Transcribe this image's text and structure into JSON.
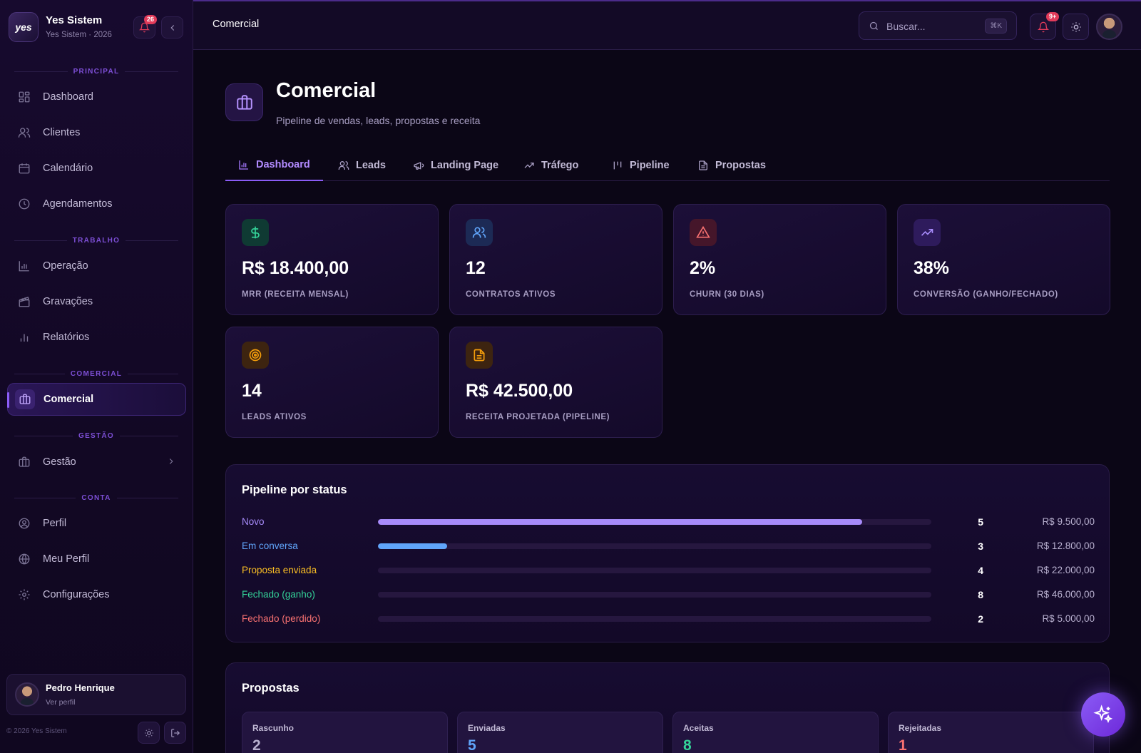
{
  "app": {
    "name": "Yes Sistem",
    "subtitle": "Yes Sistem · 2026",
    "logo_text": "yes",
    "notifications_badge": "26",
    "copyright": "© 2026 Yes Sistem"
  },
  "sidebar": {
    "sections": {
      "principal": "PRINCIPAL",
      "trabalho": "TRABALHO",
      "comercial": "COMERCIAL",
      "gestao": "GESTÃO",
      "conta": "CONTA"
    },
    "items": {
      "dashboard": "Dashboard",
      "clientes": "Clientes",
      "calendario": "Calendário",
      "agendamentos": "Agendamentos",
      "operacao": "Operação",
      "gravacoes": "Gravações",
      "relatorios": "Relatórios",
      "comercial": "Comercial",
      "gestao": "Gestão",
      "perfil": "Perfil",
      "meu_perfil": "Meu Perfil",
      "configuracoes": "Configurações"
    },
    "active": "comercial",
    "user": {
      "name": "Pedro Henrique",
      "link": "Ver perfil"
    }
  },
  "topbar": {
    "title": "Comercial",
    "search_placeholder": "Buscar...",
    "search_shortcut": "⌘K",
    "notifications_badge": "9+"
  },
  "page": {
    "title": "Comercial",
    "subtitle": "Pipeline de vendas, leads, propostas e receita"
  },
  "tabs": {
    "dashboard": "Dashboard",
    "leads": "Leads",
    "landing": "Landing Page",
    "trafego": "Tráfego",
    "pipeline": "Pipeline",
    "propostas": "Propostas"
  },
  "kpis": [
    {
      "value": "R$ 18.400,00",
      "label": "MRR (RECEITA MENSAL)",
      "icon": "dollar-icon",
      "color": "#34d399"
    },
    {
      "value": "12",
      "label": "CONTRATOS ATIVOS",
      "icon": "users-icon",
      "color": "#60a5fa"
    },
    {
      "value": "2%",
      "label": "CHURN (30 DIAS)",
      "icon": "alert-triangle-icon",
      "color": "#f87171"
    },
    {
      "value": "38%",
      "label": "CONVERSÃO (GANHO/FECHADO)",
      "icon": "trending-up-icon",
      "color": "#a78bfa"
    },
    {
      "value": "14",
      "label": "LEADS ATIVOS",
      "icon": "target-icon",
      "color": "#f59e0b"
    },
    {
      "value": "R$ 42.500,00",
      "label": "RECEITA PROJETADA (PIPELINE)",
      "icon": "document-icon",
      "color": "#f59e0b"
    }
  ],
  "pipeline": {
    "title": "Pipeline por status",
    "rows": [
      {
        "label": "Novo",
        "count": "5",
        "amount": "R$ 9.500,00",
        "fill": 0.875,
        "color": "#a78bfa"
      },
      {
        "label": "Em conversa",
        "count": "3",
        "amount": "R$ 12.800,00",
        "fill": 0.125,
        "color": "#60a5fa"
      },
      {
        "label": "Proposta enviada",
        "count": "4",
        "amount": "R$ 22.000,00",
        "fill": 0,
        "color": "#fbbf24"
      },
      {
        "label": "Fechado (ganho)",
        "count": "8",
        "amount": "R$ 46.000,00",
        "fill": 0,
        "color": "#34d399"
      },
      {
        "label": "Fechado (perdido)",
        "count": "2",
        "amount": "R$ 5.000,00",
        "fill": 0,
        "color": "#f87171"
      }
    ]
  },
  "propostas": {
    "title": "Propostas",
    "cards": [
      {
        "label": "Rascunho",
        "value": "2",
        "color": "#b8b0cf"
      },
      {
        "label": "Enviadas",
        "value": "5",
        "color": "#60a5fa"
      },
      {
        "label": "Aceitas",
        "value": "8",
        "color": "#34d399"
      },
      {
        "label": "Rejeitadas",
        "value": "1",
        "color": "#f87171"
      }
    ]
  }
}
